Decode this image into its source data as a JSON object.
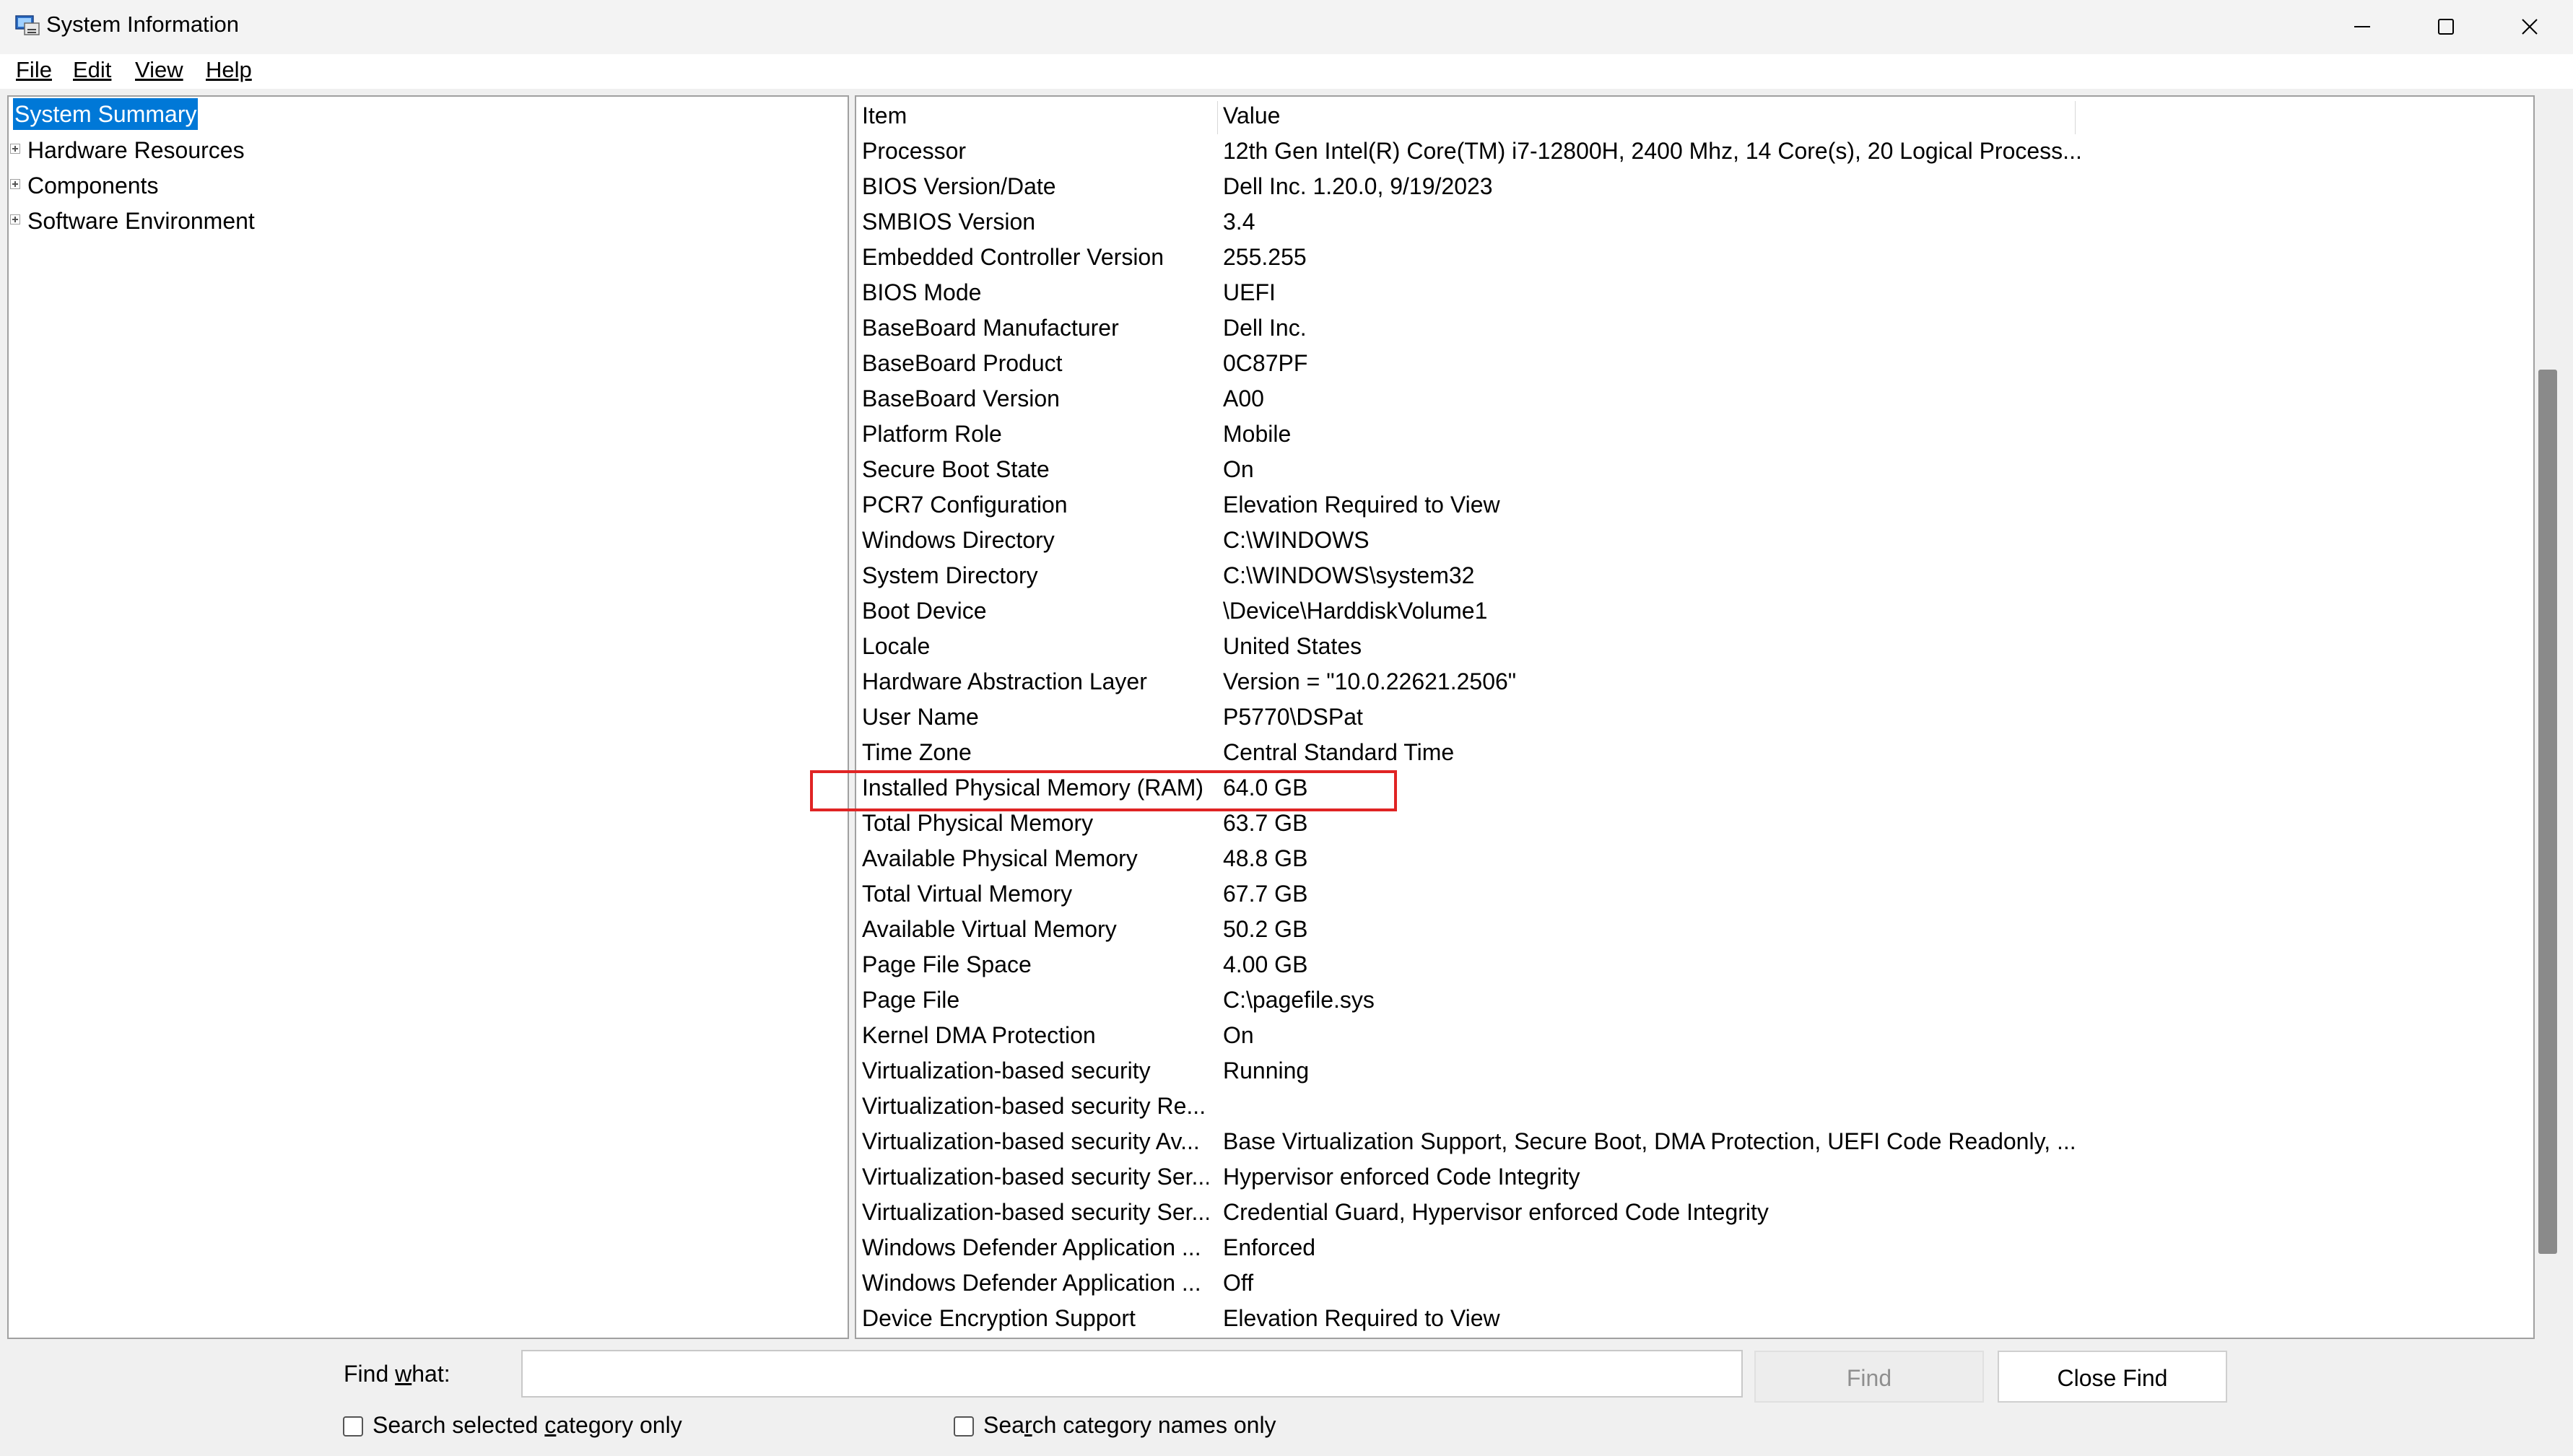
{
  "window": {
    "title": "System Information",
    "icon": "system-information-app-icon"
  },
  "menu": {
    "items": [
      {
        "label": "File"
      },
      {
        "label": "Edit"
      },
      {
        "label": "View"
      },
      {
        "label": "Help"
      }
    ]
  },
  "tree": {
    "items": [
      {
        "label": "System Summary",
        "selected": true,
        "expandable": false
      },
      {
        "label": "Hardware Resources",
        "expandable": true
      },
      {
        "label": "Components",
        "expandable": true
      },
      {
        "label": "Software Environment",
        "expandable": true
      }
    ]
  },
  "list": {
    "headers": {
      "item": "Item",
      "value": "Value"
    },
    "rows": [
      {
        "item": "Processor",
        "value": "12th Gen Intel(R) Core(TM) i7-12800H, 2400 Mhz, 14 Core(s), 20 Logical Process..."
      },
      {
        "item": "BIOS Version/Date",
        "value": "Dell Inc. 1.20.0, 9/19/2023"
      },
      {
        "item": "SMBIOS Version",
        "value": "3.4"
      },
      {
        "item": "Embedded Controller Version",
        "value": "255.255"
      },
      {
        "item": "BIOS Mode",
        "value": "UEFI"
      },
      {
        "item": "BaseBoard Manufacturer",
        "value": "Dell Inc."
      },
      {
        "item": "BaseBoard Product",
        "value": "0C87PF"
      },
      {
        "item": "BaseBoard Version",
        "value": "A00"
      },
      {
        "item": "Platform Role",
        "value": "Mobile"
      },
      {
        "item": "Secure Boot State",
        "value": "On"
      },
      {
        "item": "PCR7 Configuration",
        "value": "Elevation Required to View"
      },
      {
        "item": "Windows Directory",
        "value": "C:\\WINDOWS"
      },
      {
        "item": "System Directory",
        "value": "C:\\WINDOWS\\system32"
      },
      {
        "item": "Boot Device",
        "value": "\\Device\\HarddiskVolume1"
      },
      {
        "item": "Locale",
        "value": "United States"
      },
      {
        "item": "Hardware Abstraction Layer",
        "value": "Version = \"10.0.22621.2506\""
      },
      {
        "item": "User Name",
        "value": "P5770\\DSPat"
      },
      {
        "item": "Time Zone",
        "value": "Central Standard Time"
      },
      {
        "item": "Installed Physical Memory (RAM)",
        "value": "64.0 GB"
      },
      {
        "item": "Total Physical Memory",
        "value": "63.7 GB"
      },
      {
        "item": "Available Physical Memory",
        "value": "48.8 GB"
      },
      {
        "item": "Total Virtual Memory",
        "value": "67.7 GB"
      },
      {
        "item": "Available Virtual Memory",
        "value": "50.2 GB"
      },
      {
        "item": "Page File Space",
        "value": "4.00 GB"
      },
      {
        "item": "Page File",
        "value": "C:\\pagefile.sys"
      },
      {
        "item": "Kernel DMA Protection",
        "value": "On"
      },
      {
        "item": "Virtualization-based security",
        "value": "Running"
      },
      {
        "item": "Virtualization-based security Re...",
        "value": ""
      },
      {
        "item": "Virtualization-based security Av...",
        "value": "Base Virtualization Support, Secure Boot, DMA Protection, UEFI Code Readonly, ..."
      },
      {
        "item": "Virtualization-based security Ser...",
        "value": "Hypervisor enforced Code Integrity"
      },
      {
        "item": "Virtualization-based security Ser...",
        "value": "Credential Guard, Hypervisor enforced Code Integrity"
      },
      {
        "item": "Windows Defender Application ...",
        "value": "Enforced"
      },
      {
        "item": "Windows Defender Application ...",
        "value": "Off"
      },
      {
        "item": "Device Encryption Support",
        "value": "Elevation Required to View"
      }
    ]
  },
  "find": {
    "label_pre": "Find ",
    "label_acc": "w",
    "label_post": "hat:",
    "input_value": "",
    "find_button": "Find",
    "close_button": "Close Find",
    "check1_pre": "Search selected ",
    "check1_acc": "c",
    "check1_post": "ategory only",
    "check1_checked": false,
    "check2_pre": "Sea",
    "check2_acc": "r",
    "check2_post": "ch category names only",
    "check2_checked": false
  },
  "colors": {
    "selection": "#0078d7",
    "highlight_box": "#e02424"
  }
}
